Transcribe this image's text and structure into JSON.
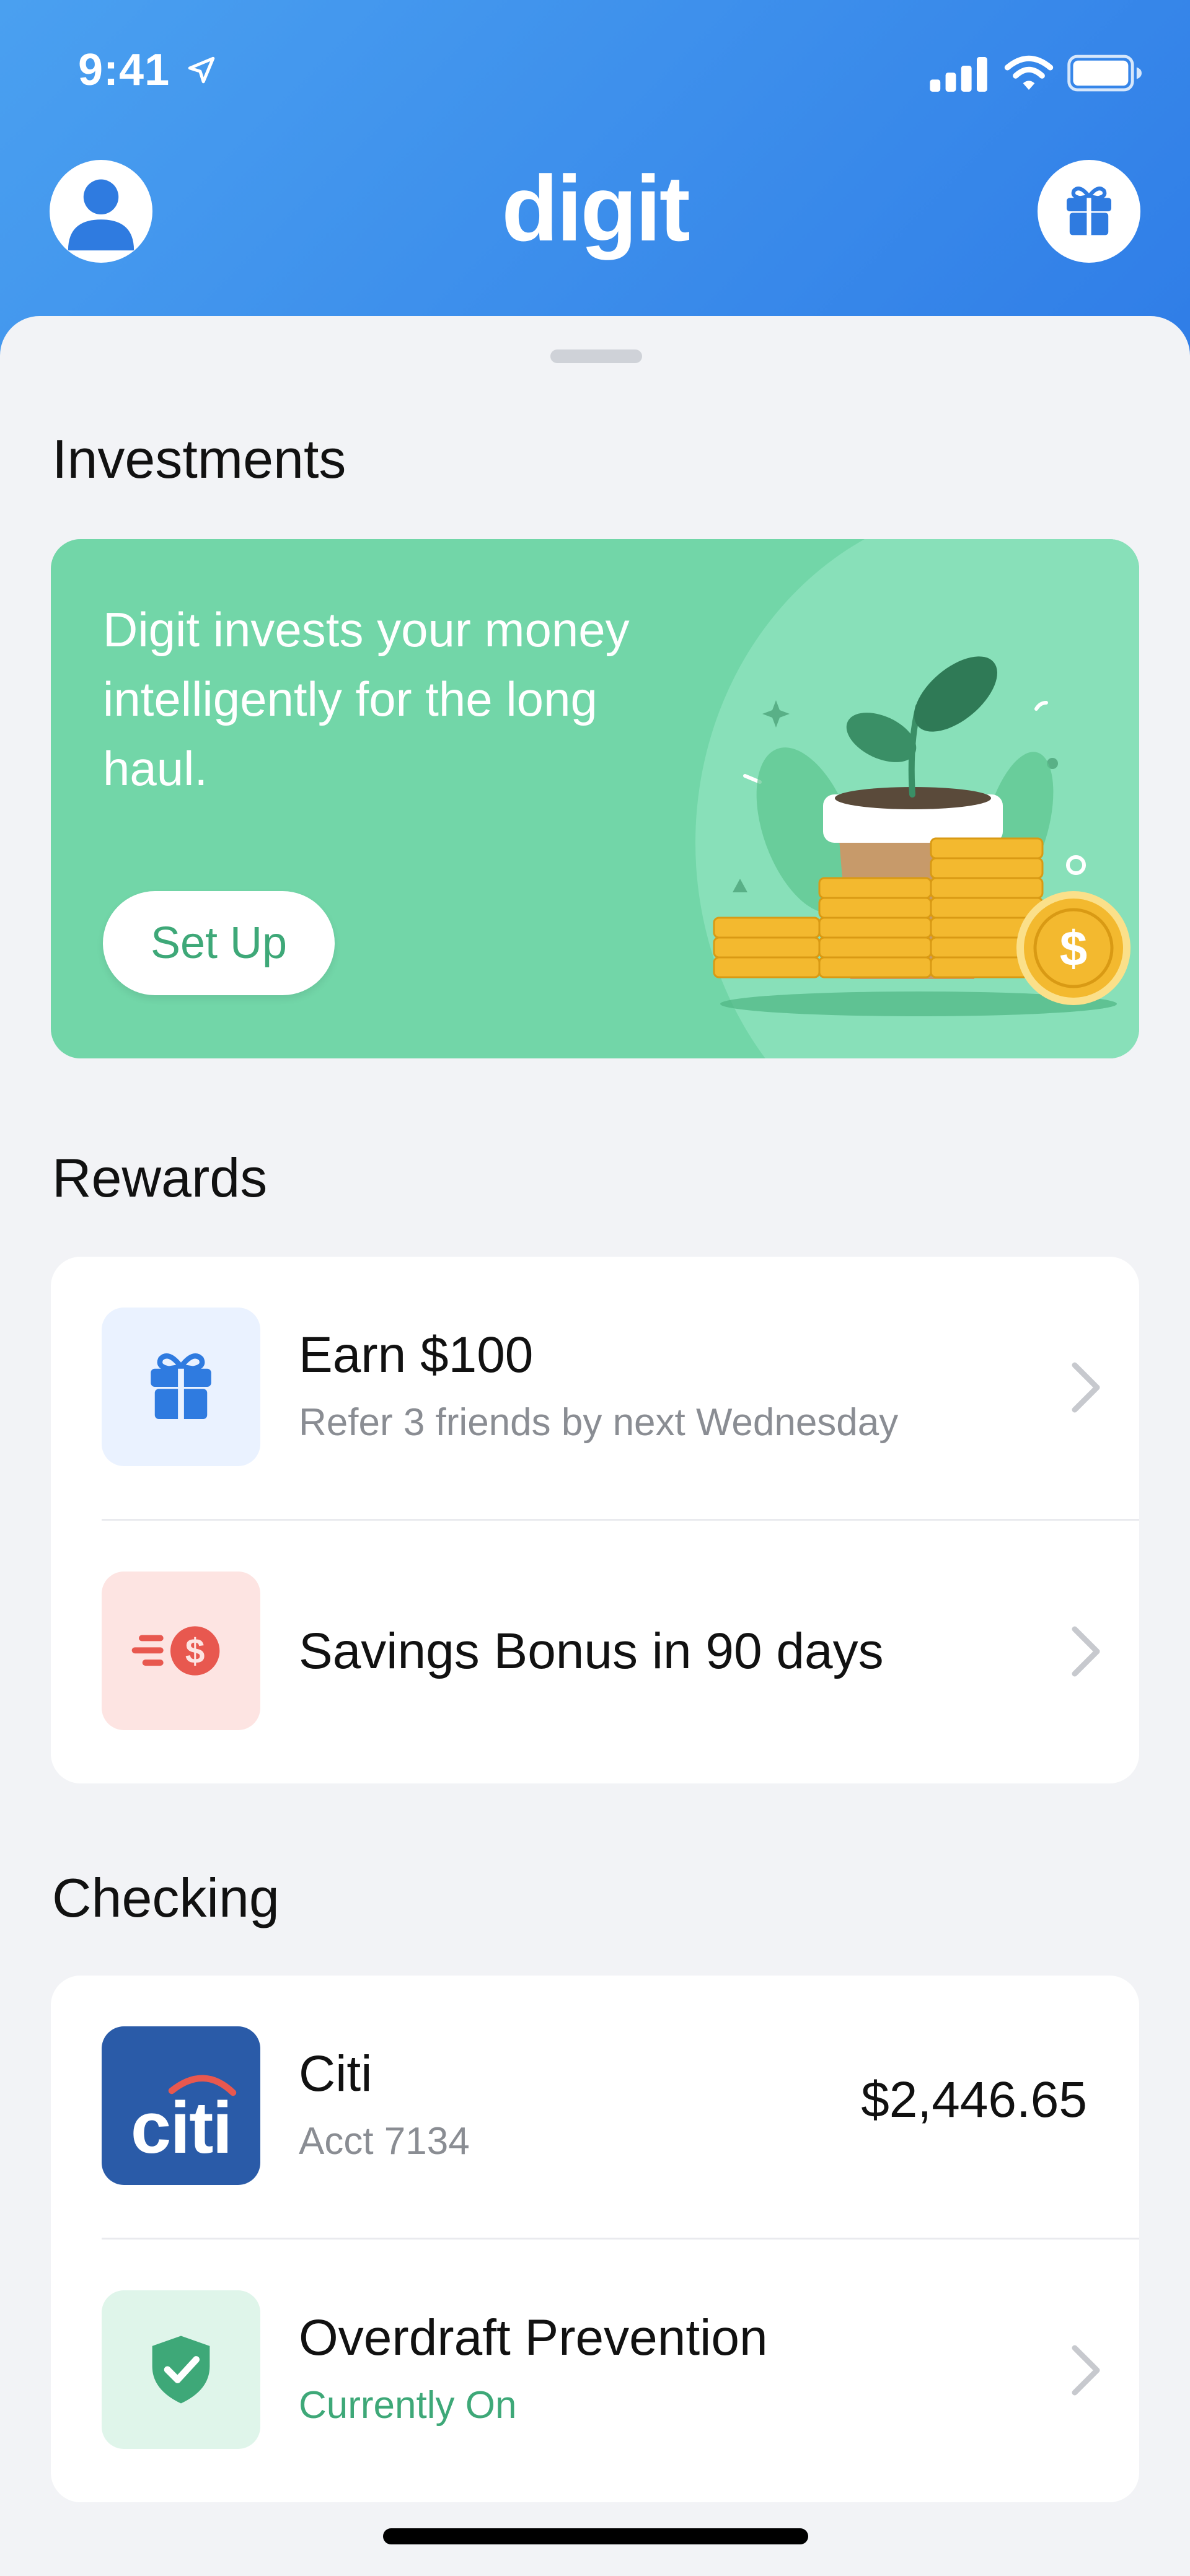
{
  "status_bar": {
    "time": "9:41"
  },
  "header": {
    "brand": "digit",
    "profile_icon": "person-icon",
    "gift_icon": "gift-icon"
  },
  "investments": {
    "section_title": "Investments",
    "description": "Digit invests your money intelligently for the long haul.",
    "button_label": "Set Up",
    "illustration": "plant-coins-illustration",
    "card_color": "#72d6a8"
  },
  "rewards": {
    "section_title": "Rewards",
    "items": [
      {
        "title": "Earn $100",
        "subtitle": "Refer 3 friends by next Wednesday",
        "icon": "gift-icon"
      },
      {
        "title": "Savings Bonus in 90 days",
        "icon": "dollar-speed-icon"
      }
    ]
  },
  "checking": {
    "section_title": "Checking",
    "account": {
      "bank_logo_text": "citi",
      "name": "Citi",
      "account": "Acct 7134",
      "balance": "$2,446.65"
    },
    "overdraft": {
      "title": "Overdraft Prevention",
      "status": "Currently On",
      "icon": "shield-check-icon"
    }
  },
  "colors": {
    "header_blue": "#2d7ae6",
    "accent_green": "#3ea878",
    "citi_blue": "#2a5ba8",
    "gift_tile_bg": "#eaf2ff",
    "bonus_tile_bg": "#fde4e2",
    "shield_tile_bg": "#dff5ea"
  }
}
